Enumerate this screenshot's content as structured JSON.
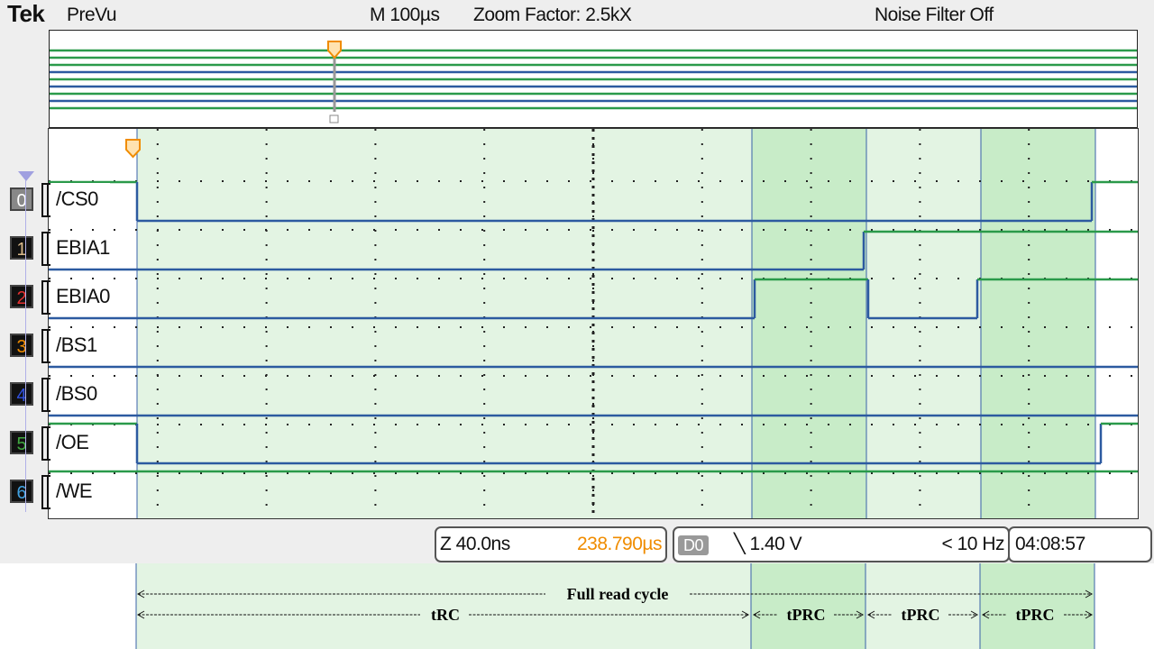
{
  "header": {
    "brand": "Tek",
    "mode": "PreVu",
    "timebase": "M 100µs",
    "zoom": "Zoom Factor: 2.5kX",
    "noise_filter": "Noise Filter Off"
  },
  "channels": [
    {
      "num": "0",
      "label": "/CS0",
      "badge_bg": "#888888",
      "num_color": "#ffffff"
    },
    {
      "num": "1",
      "label": "EBIA1",
      "badge_bg": "#111111",
      "num_color": "#d9b98a"
    },
    {
      "num": "2",
      "label": "EBIA0",
      "badge_bg": "#111111",
      "num_color": "#e53030"
    },
    {
      "num": "3",
      "label": "/BS1",
      "badge_bg": "#111111",
      "num_color": "#f08c00"
    },
    {
      "num": "4",
      "label": "/BS0",
      "badge_bg": "#111111",
      "num_color": "#3050e0"
    },
    {
      "num": "5",
      "label": "/OE",
      "badge_bg": "#111111",
      "num_color": "#40a840"
    },
    {
      "num": "6",
      "label": "/WE",
      "badge_bg": "#111111",
      "num_color": "#40a0e0"
    }
  ],
  "status_bar": {
    "zoom_scale": "Z 40.0ns",
    "zoom_position": "238.790µs",
    "trigger_source": "D0",
    "trigger_level": "╲ 1.40 V",
    "trigger_freq": "< 10 Hz",
    "clock": "04:08:57"
  },
  "annotations": {
    "full_cycle": "Full read cycle",
    "trc": "tRC",
    "tprc1": "tPRC",
    "tprc2": "tPRC",
    "tprc3": "tPRC"
  },
  "colors": {
    "high_trace": "#2a9a4a",
    "low_trace": "#2c5aa0",
    "shade_light": "#e3f4e3",
    "shade_dark": "#c8ecc8",
    "marker": "#f08c00"
  }
}
